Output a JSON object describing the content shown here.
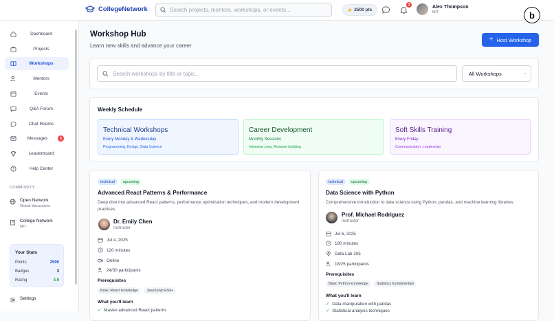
{
  "header": {
    "app_name": "CollegeNetwork",
    "search_placeholder": "Search projects, mentors, workshops, or events...",
    "points": "2500 pts",
    "notification_count": "3",
    "user_name": "Alex Thompson",
    "user_school": "MIT",
    "brand_badge": "b"
  },
  "sidebar": {
    "items": [
      {
        "label": "Dashboard",
        "icon": "home-icon"
      },
      {
        "label": "Projects",
        "icon": "briefcase-icon"
      },
      {
        "label": "Workshops",
        "icon": "book-icon"
      },
      {
        "label": "Mentors",
        "icon": "users-icon"
      },
      {
        "label": "Events",
        "icon": "calendar-icon"
      },
      {
        "label": "Q&A Forum",
        "icon": "chat-icon"
      },
      {
        "label": "Chat Rooms",
        "icon": "chat-bubble-icon"
      },
      {
        "label": "Messages",
        "icon": "mail-icon",
        "badge": "5"
      },
      {
        "label": "Leaderboard",
        "icon": "trophy-icon"
      },
      {
        "label": "Help Center",
        "icon": "help-icon"
      }
    ],
    "community_title": "COMMUNITY",
    "community": [
      {
        "name": "Open Network",
        "sub": "Global discussions"
      },
      {
        "name": "College Network",
        "sub": "MIT"
      }
    ],
    "stats": {
      "title": "Your Stats",
      "rows": [
        {
          "label": "Points",
          "value": "2500",
          "color": "#1d4ed8"
        },
        {
          "label": "Badges",
          "value": "3",
          "color": "#111827"
        },
        {
          "label": "Rating",
          "value": "4.9",
          "color": "#16a34a"
        }
      ]
    },
    "settings_label": "Settings"
  },
  "main": {
    "title": "Workshop Hub",
    "subtitle": "Learn new skills and advance your career",
    "host_button": "Host Workshop",
    "search_placeholder": "Search workshops by title or topic...",
    "filter_value": "All Workshops",
    "schedule": {
      "title": "Weekly Schedule",
      "items": [
        {
          "title": "Technical Workshops",
          "when": "Every Monday & Wednesday",
          "topics": "Programming, Design, Data Science"
        },
        {
          "title": "Career Development",
          "when": "Monthly Sessions",
          "topics": "Interview prep, Resume building"
        },
        {
          "title": "Soft Skills Training",
          "when": "Every Friday",
          "topics": "Communication, Leadership"
        }
      ]
    },
    "workshops": [
      {
        "tags": [
          "technical",
          "upcoming"
        ],
        "title": "Advanced React Patterns & Performance",
        "description": "Deep dive into advanced React patterns, performance optimization techniques, and modern development practices.",
        "instructor": "Dr. Emily Chen",
        "instructor_role": "Instructor",
        "date": "Jul 4, 2025",
        "duration": "120 minutes",
        "location": "Online",
        "participants": "24/30 participants",
        "prereq_title": "Prerequisites",
        "prereqs": [
          "Basic React knowledge",
          "JavaScript ES6+"
        ],
        "learn_title": "What you'll learn",
        "learn": [
          "Master advanced React patterns"
        ]
      },
      {
        "tags": [
          "technical",
          "upcoming"
        ],
        "title": "Data Science with Python",
        "description": "Comprehensive introduction to data science using Python, pandas, and machine learning libraries.",
        "instructor": "Prof. Michael Rodriguez",
        "instructor_role": "Instructor",
        "date": "Jul 6, 2025",
        "duration": "180 minutes",
        "location": "Data Lab 205",
        "participants": "18/25 participants",
        "prereq_title": "Prerequisites",
        "prereqs": [
          "Basic Python knowledge",
          "Statistics fundamentals"
        ],
        "learn_title": "What you'll learn",
        "learn": [
          "Data manipulation with pandas",
          "Statistical analysis techniques"
        ]
      }
    ]
  }
}
